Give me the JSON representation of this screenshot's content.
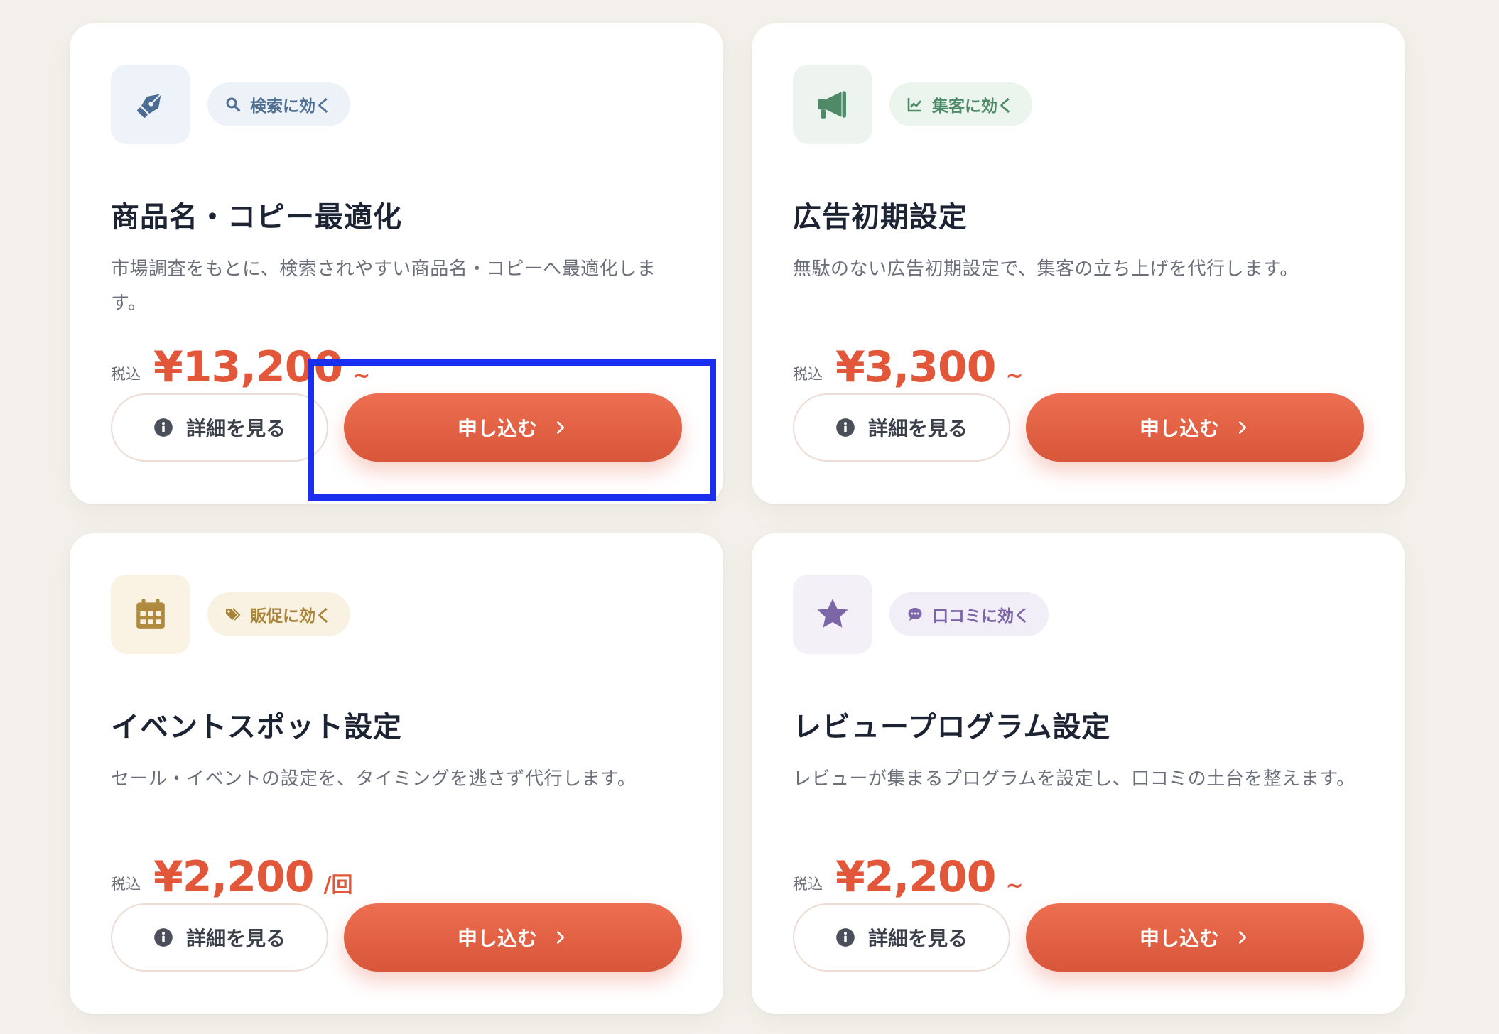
{
  "common": {
    "tax_label": "税込",
    "detail_label": "詳細を見る",
    "apply_label": "申し込む"
  },
  "cards": [
    {
      "tag": "検索に効く",
      "title": "商品名・コピー最適化",
      "description": "市場調査をもとに、検索されやすい商品名・コピーへ最適化します。",
      "price": "¥13,200",
      "suffix": "~",
      "icon": "pen-nib-icon",
      "tag_icon": "search-icon",
      "colors": {
        "icon_bg": "#eef3fa",
        "icon_fg": "#4b6d94",
        "tag_bg": "#edf2f8",
        "tag_fg": "#4f6f93"
      }
    },
    {
      "tag": "集客に効く",
      "title": "広告初期設定",
      "description": "無駄のない広告初期設定で、集客の立ち上げを代行します。",
      "price": "¥3,300",
      "suffix": "~",
      "icon": "megaphone-icon",
      "tag_icon": "chart-line-icon",
      "colors": {
        "icon_bg": "#edf4ef",
        "icon_fg": "#4e8a68",
        "tag_bg": "#ecf4ee",
        "tag_fg": "#4e8a68"
      }
    },
    {
      "tag": "販促に効く",
      "title": "イベントスポット設定",
      "description": "セール・イベントの設定を、タイミングを逃さず代行します。",
      "price": "¥2,200",
      "suffix": "/回",
      "icon": "calendar-icon",
      "tag_icon": "tags-icon",
      "colors": {
        "icon_bg": "#faf3e4",
        "icon_fg": "#b08a3e",
        "tag_bg": "#f9f2e2",
        "tag_fg": "#a8843a"
      }
    },
    {
      "tag": "口コミに効く",
      "title": "レビュープログラム設定",
      "description": "レビューが集まるプログラムを設定し、口コミの土台を整えます。",
      "price": "¥2,200",
      "suffix": "~",
      "icon": "star-icon",
      "tag_icon": "comment-dots-icon",
      "colors": {
        "icon_bg": "#f3f0f8",
        "icon_fg": "#7c66a8",
        "tag_bg": "#f2eef8",
        "tag_fg": "#7c66a8"
      }
    }
  ],
  "highlight": {
    "color": "#1a2ef0",
    "target": "card-1-apply-button"
  }
}
